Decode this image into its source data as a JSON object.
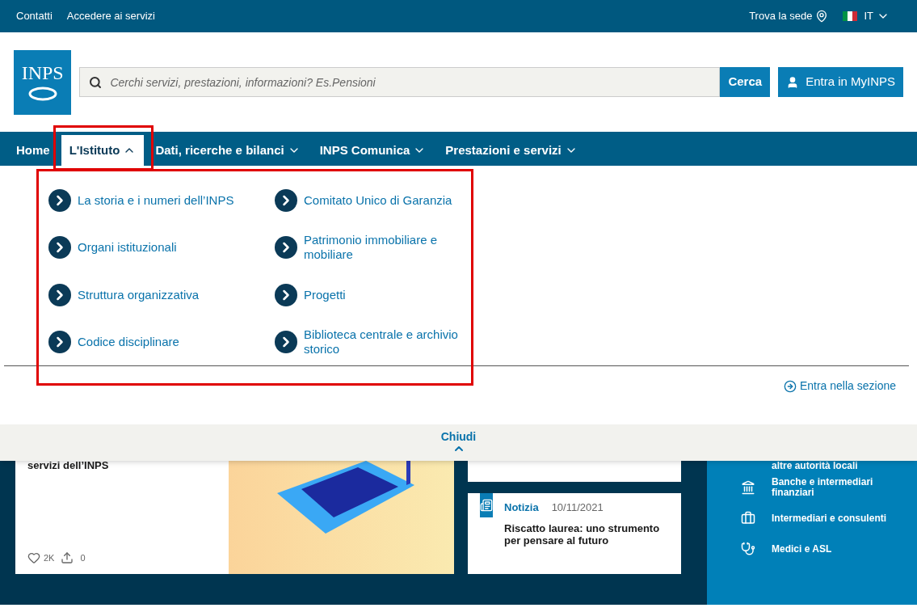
{
  "top_bar": {
    "links": [
      "Contatti",
      "Accedere ai servizi"
    ],
    "locate": "Trova la sede",
    "language": "IT"
  },
  "header": {
    "logo": "INPS",
    "search": {
      "placeholder": "Cerchi servizi, prestazioni, informazioni? Es.Pensioni",
      "button": "Cerca"
    },
    "login": "Entra in MyINPS"
  },
  "nav": [
    {
      "label": "Home",
      "selected": false,
      "dropdown": false
    },
    {
      "label": "L'Istituto",
      "selected": true,
      "dropdown": true
    },
    {
      "label": "Dati, ricerche e bilanci",
      "selected": false,
      "dropdown": true
    },
    {
      "label": "INPS Comunica",
      "selected": false,
      "dropdown": true
    },
    {
      "label": "Prestazioni e servizi",
      "selected": false,
      "dropdown": true
    }
  ],
  "menu": {
    "columns": [
      [
        "La storia e i numeri dell’INPS",
        "Organi istituzionali",
        "Struttura organizzativa",
        "Codice disciplinare"
      ],
      [
        "Comitato Unico di Garanzia",
        "Patrimonio immobiliare e mobiliare",
        "Progetti",
        "Biblioteca centrale e archivio storico"
      ]
    ],
    "section_link": "Entra nella sezione",
    "close": "Chiudi"
  },
  "background": {
    "card_title": "servizi dell’INPS",
    "likes": "2K",
    "shares": "0",
    "news": {
      "type": "Notizia",
      "date": "10/11/2021",
      "title": "Riscatto laurea: uno strumento per pensare al futuro"
    },
    "side_links": [
      "altre autorità locali",
      "Banche e intermediari finanziari",
      "Intermediari e consulenti",
      "Medici e ASL"
    ]
  }
}
